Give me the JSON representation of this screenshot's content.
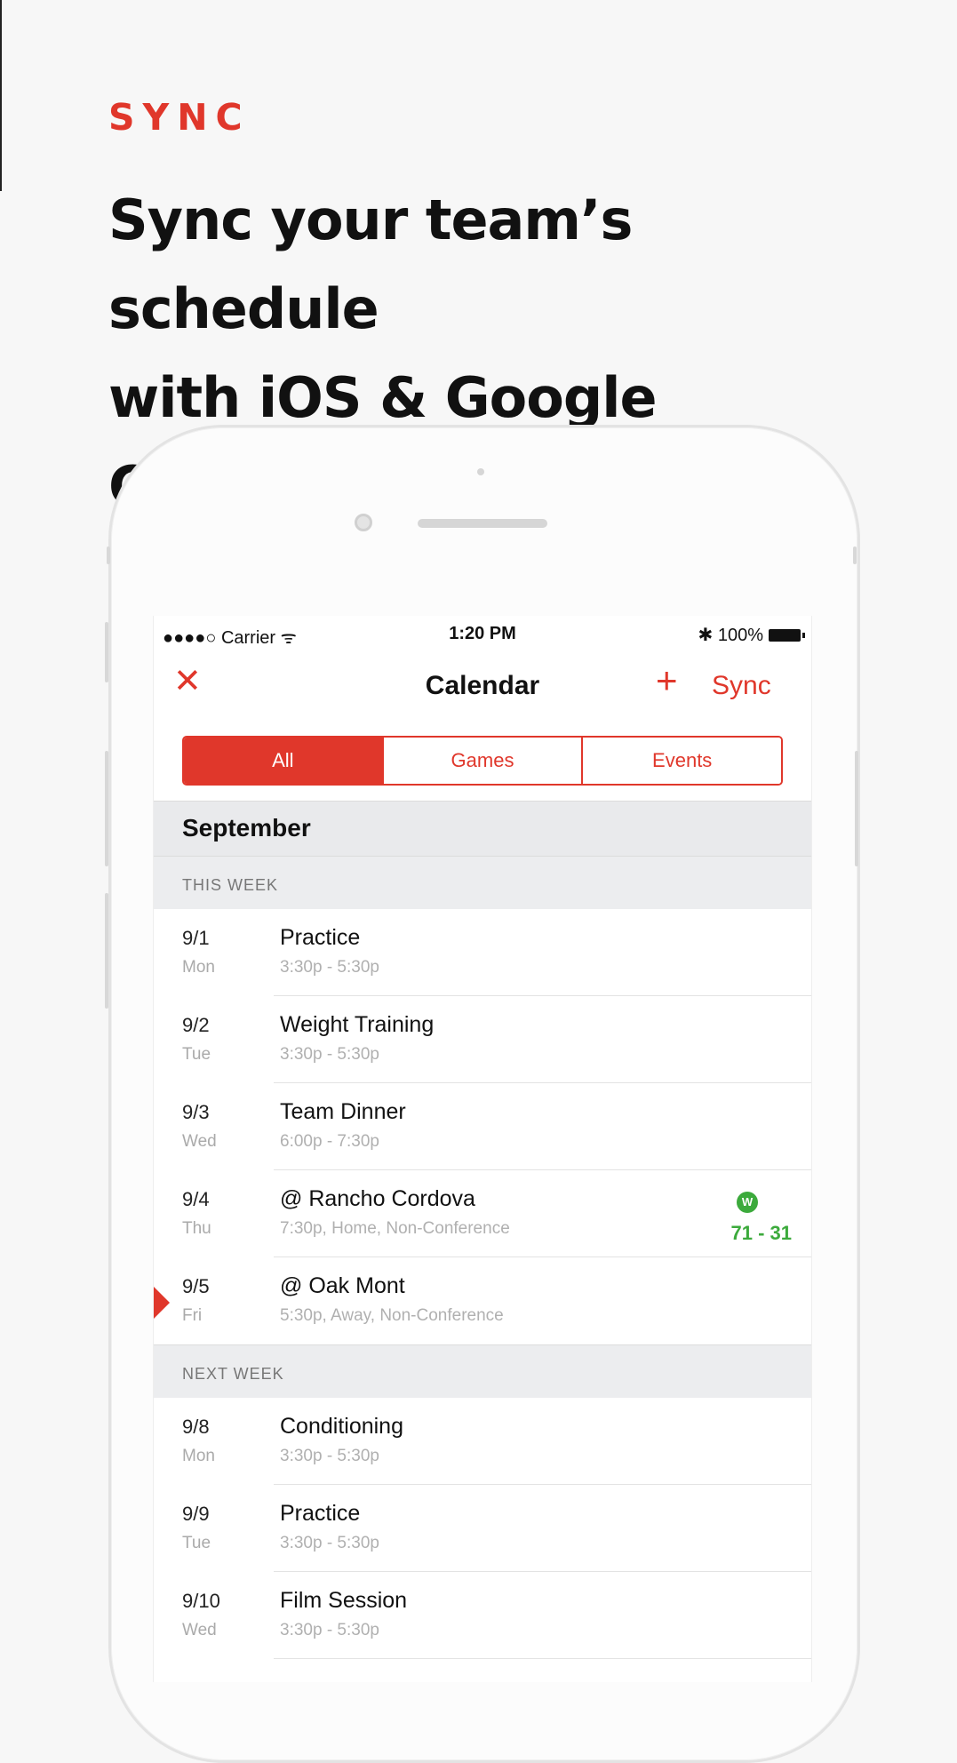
{
  "header": {
    "kicker": "SYNC",
    "headline_line1": "Sync your team’s schedule",
    "headline_line2": "with iOS & Google Calendar"
  },
  "statusbar": {
    "carrier": "●●●●○ Carrier ᯤ",
    "time": "1:20 PM",
    "battery": "✱ 100%"
  },
  "navbar": {
    "close_icon": "close-icon",
    "title": "Calendar",
    "add_icon": "plus-icon",
    "sync_label": "Sync"
  },
  "segments": [
    {
      "label": "All",
      "active": true
    },
    {
      "label": "Games",
      "active": false
    },
    {
      "label": "Events",
      "active": false
    }
  ],
  "month": "September",
  "sections": [
    {
      "label": "THIS WEEK",
      "events": [
        {
          "date": "9/1",
          "dow": "Mon",
          "title": "Practice",
          "sub": "3:30p - 5:30p"
        },
        {
          "date": "9/2",
          "dow": "Tue",
          "title": "Weight Training",
          "sub": "3:30p - 5:30p"
        },
        {
          "date": "9/3",
          "dow": "Wed",
          "title": "Team Dinner",
          "sub": "6:00p - 7:30p"
        },
        {
          "date": "9/4",
          "dow": "Thu",
          "title": "@ Rancho Cordova",
          "sub": "7:30p, Home, Non-Conference",
          "result_badge": "W",
          "score": "71 - 31"
        },
        {
          "date": "9/5",
          "dow": "Fri",
          "title": "@ Oak Mont",
          "sub": "5:30p, Away, Non-Conference",
          "current": true
        }
      ]
    },
    {
      "label": "NEXT WEEK",
      "events": [
        {
          "date": "9/8",
          "dow": "Mon",
          "title": "Conditioning",
          "sub": "3:30p - 5:30p"
        },
        {
          "date": "9/9",
          "dow": "Tue",
          "title": "Practice",
          "sub": "3:30p - 5:30p"
        },
        {
          "date": "9/10",
          "dow": "Wed",
          "title": "Film Session",
          "sub": "3:30p - 5:30p"
        }
      ]
    }
  ],
  "colors": {
    "accent": "#e0372b",
    "win": "#3caa3c"
  }
}
